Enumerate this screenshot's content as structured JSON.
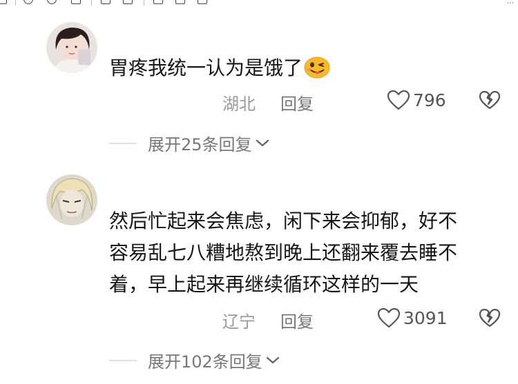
{
  "comments": [
    {
      "text": "胃疼我统一认为是饿了",
      "emoji_icon": "wink-tongue-emoji-icon",
      "location": "湖北",
      "reply_label": "回复",
      "likes": "796",
      "expand_label": "展开25条回复"
    },
    {
      "text_lines": [
        "然后忙起来会焦虑，闲下来会抑郁，好不",
        "容易乱七八糟地熬到晚上还翻来覆去睡不",
        "着，早上起来再继续循环这样的一天"
      ],
      "location": "辽宁",
      "reply_label": "回复",
      "likes": "3091",
      "expand_label": "展开102条回复"
    }
  ],
  "icons": {
    "like": "heart-outline-icon",
    "dislike": "broken-heart-icon",
    "expand": "chevron-down-icon"
  },
  "colors": {
    "text": "#161616",
    "meta": "#9a9a9a",
    "emoji": "#f7b92a"
  }
}
